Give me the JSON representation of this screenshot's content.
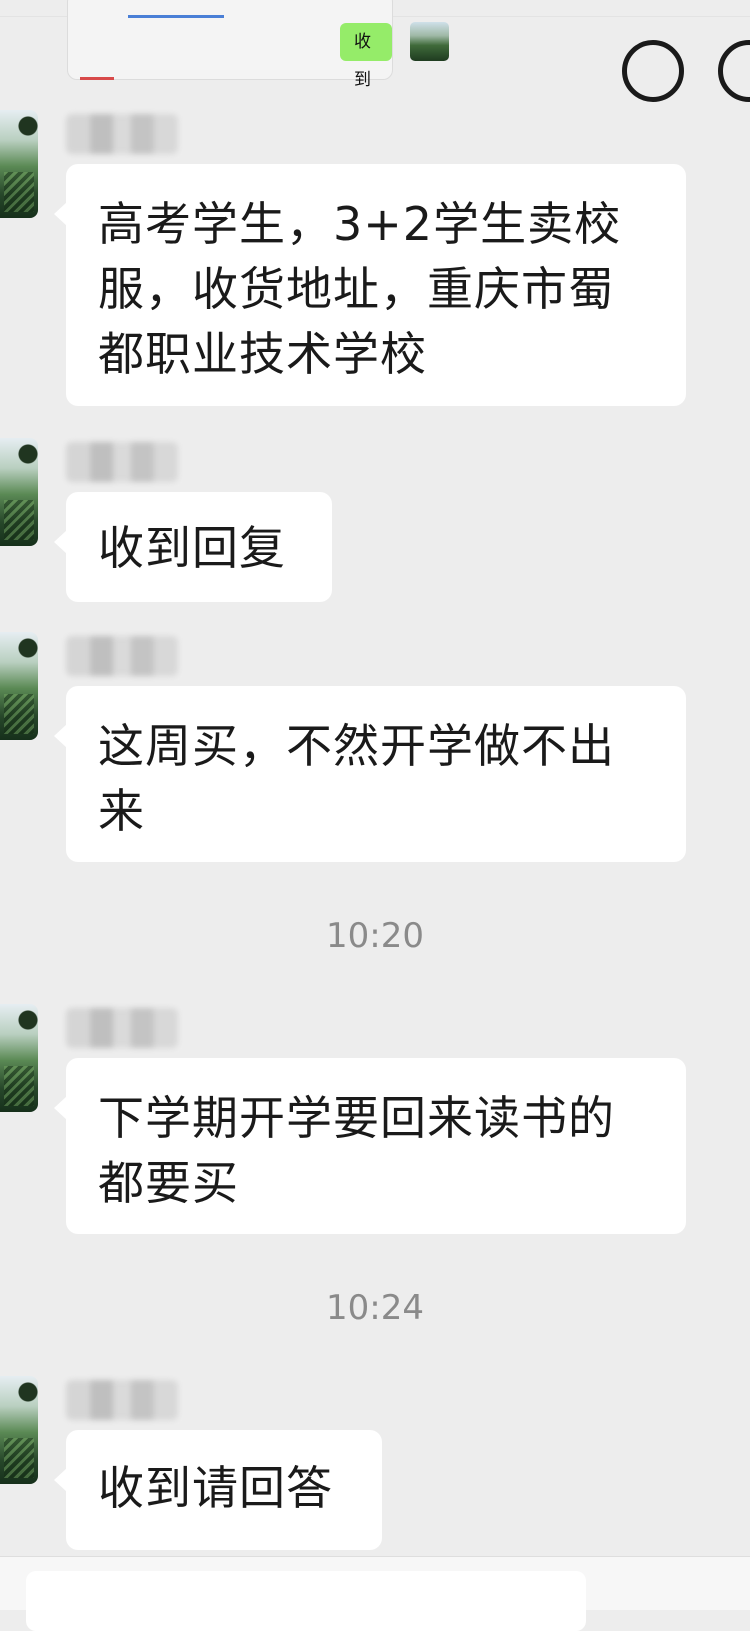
{
  "quoted_message": {
    "reply_label": "收到"
  },
  "messages": [
    {
      "text": "高考学生，3+2学生卖校服，收货地址，重庆市蜀都职业技术学校"
    },
    {
      "text": "收到回复"
    },
    {
      "text": "这周买，不然开学做不出来"
    },
    {
      "time": "10:20"
    },
    {
      "text": "下学期开学要回来读书的都要买"
    },
    {
      "time": "10:24"
    },
    {
      "text": "收到请回答"
    }
  ],
  "input_bar": {
    "icons": [
      "emoji-icon",
      "plus-icon"
    ]
  }
}
